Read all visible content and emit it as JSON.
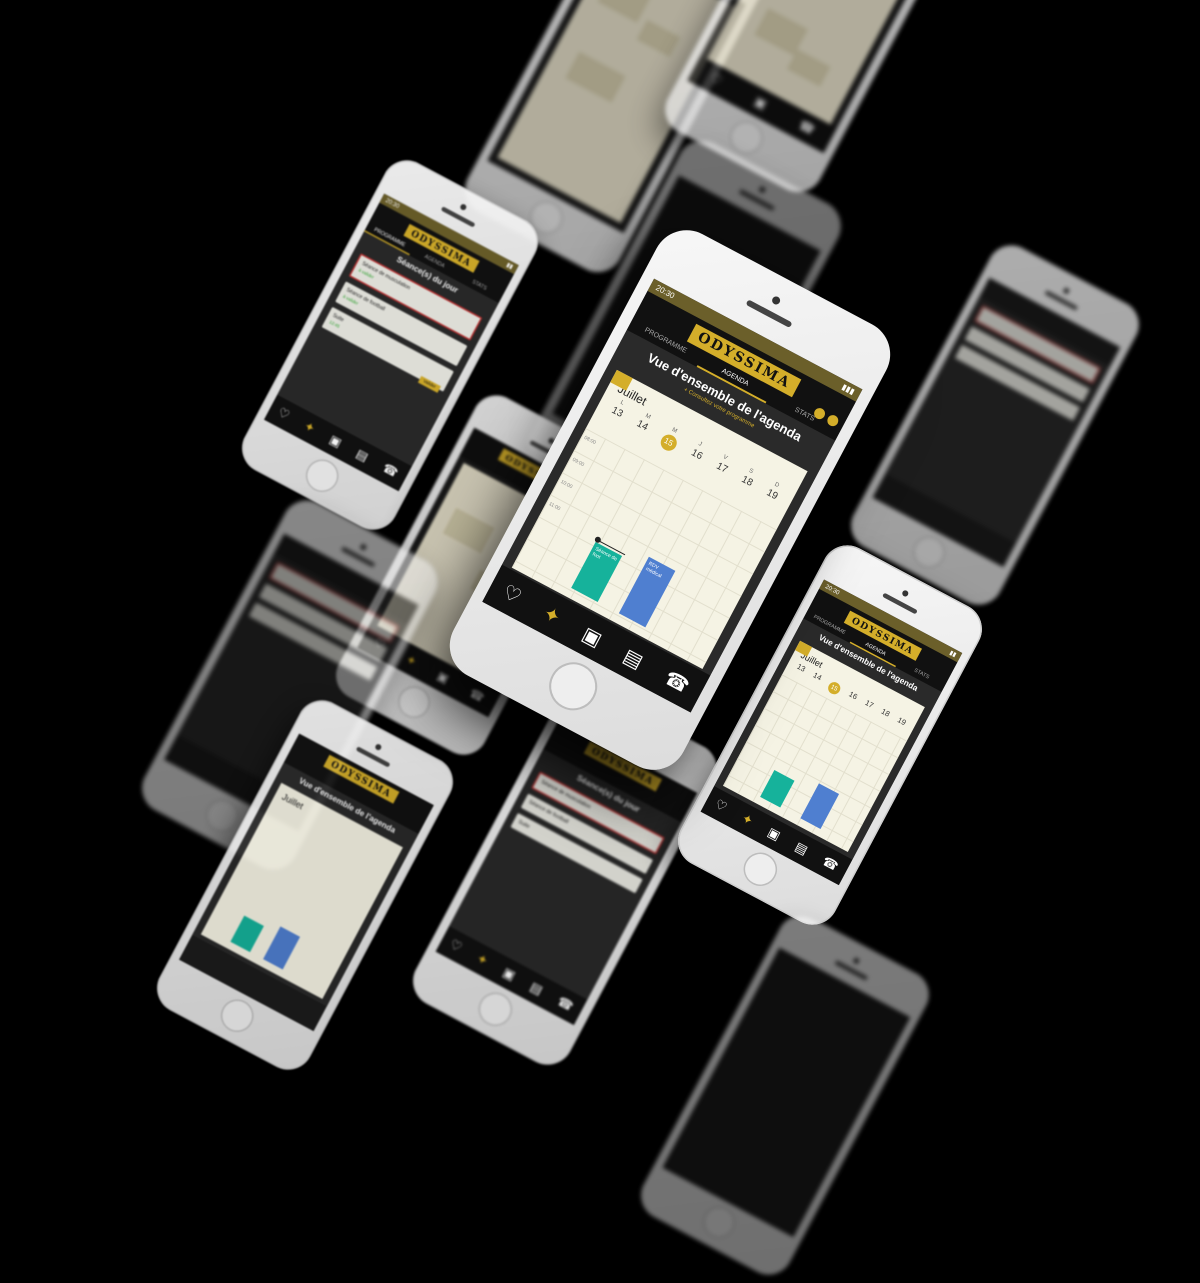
{
  "app": {
    "logo_text": "ODYSSIMA",
    "status_time": "20:30",
    "tabs": [
      "PROGRAMME",
      "AGENDA",
      "STATS"
    ],
    "active_tab": "AGENDA"
  },
  "agenda": {
    "title": "Vue d'ensemble de l'agenda",
    "program_link": "+ Consultez votre programme",
    "month": "Juillet",
    "weekdays": [
      "L",
      "M",
      "M",
      "J",
      "V",
      "S",
      "D"
    ],
    "dates": [
      "13",
      "14",
      "15",
      "16",
      "17",
      "18",
      "19"
    ],
    "today": "15",
    "hours": [
      "08:00",
      "09:00",
      "10:00",
      "11:00"
    ],
    "events": [
      {
        "label": "Séance de foot",
        "color": "#16b29b"
      },
      {
        "label": "RDV médical",
        "color": "#4f7fd0"
      }
    ]
  },
  "seances": {
    "title": "Séance(s) du jour",
    "cards": [
      {
        "label": "Séance de musculation",
        "status": "à valider"
      },
      {
        "label": "Séance de football",
        "status": "à valider"
      },
      {
        "label": "Suite",
        "status": "12:45",
        "button": "Valider"
      }
    ]
  },
  "nav": [
    "heart-pulse-icon",
    "runner-icon",
    "bag-icon",
    "document-icon",
    "phone-icon"
  ],
  "colors": {
    "accent": "#d4ae2a",
    "background": "#000000",
    "teal": "#16b29b",
    "blue": "#4f7fd0"
  }
}
